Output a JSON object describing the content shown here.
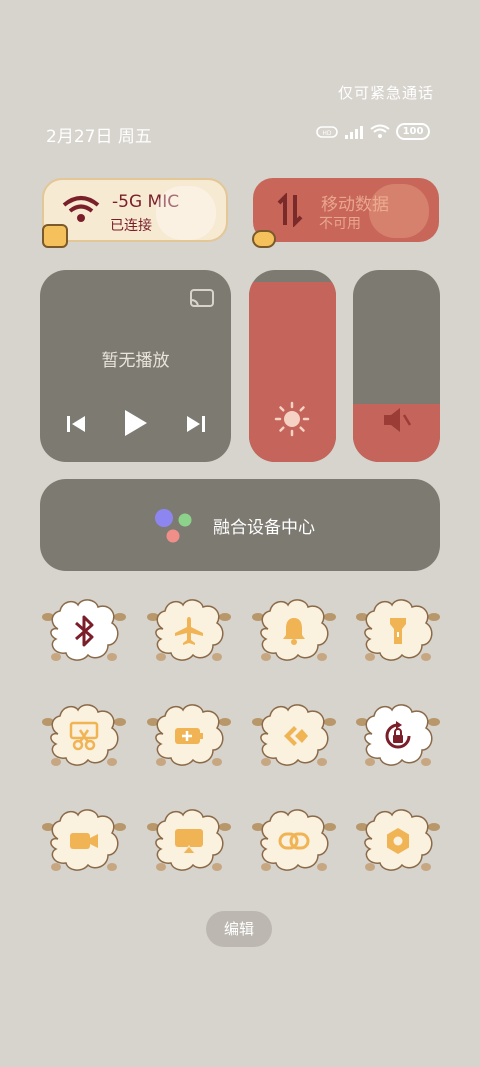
{
  "status_bar": {
    "emergency_text": "仅可紧急通话",
    "date_text": "2月27日 周五",
    "battery_text": "100"
  },
  "wifi_tile": {
    "name": "-5G   MIC",
    "status": "已连接"
  },
  "data_tile": {
    "name": "移动数据",
    "status": "不可用"
  },
  "media": {
    "title": "暂无播放"
  },
  "sliders": {
    "brightness_level": 0.94,
    "volume_level": 0.3
  },
  "device_center": {
    "label": "融合设备中心"
  },
  "tiles": [
    {
      "icon": "bluetooth-icon",
      "active": true
    },
    {
      "icon": "airplane-icon",
      "active": false
    },
    {
      "icon": "bell-icon",
      "active": false
    },
    {
      "icon": "flashlight-icon",
      "active": false
    },
    {
      "icon": "screenshot-scissors-icon",
      "active": false
    },
    {
      "icon": "battery-saver-icon",
      "active": false
    },
    {
      "icon": "connect-icon",
      "active": false
    },
    {
      "icon": "rotation-lock-icon",
      "active": true
    },
    {
      "icon": "screen-record-icon",
      "active": false
    },
    {
      "icon": "cast-icon",
      "active": false
    },
    {
      "icon": "link-icon",
      "active": false
    },
    {
      "icon": "settings-hex-icon",
      "active": false
    }
  ],
  "edit_button": {
    "label": "编辑"
  },
  "colors": {
    "panel": "#7d7a72",
    "accent_red": "#c4645a",
    "icon_orange": "#f0b454",
    "icon_dark_red": "#7a1e2a",
    "background": "#d7d3cd"
  }
}
